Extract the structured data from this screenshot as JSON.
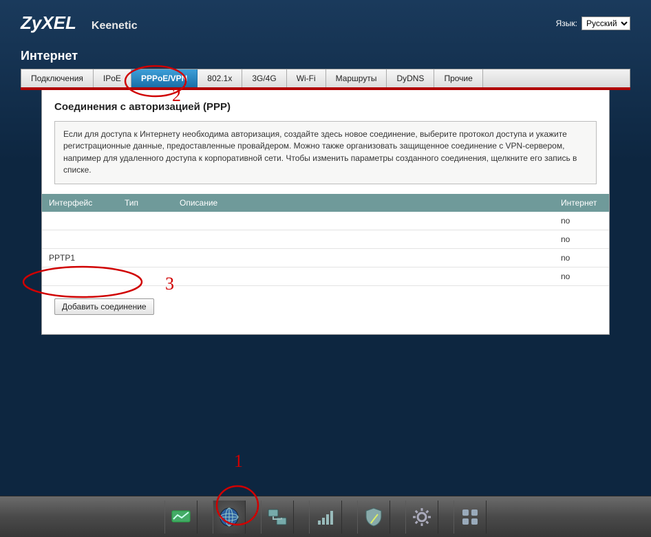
{
  "header": {
    "logo_text": "ZyXEL",
    "product": "Keenetic",
    "lang_label": "Язык:",
    "lang_value": "Русский"
  },
  "section_title": "Интернет",
  "tabs": [
    {
      "label": "Подключения",
      "active": false
    },
    {
      "label": "IPoE",
      "active": false
    },
    {
      "label": "PPPoE/VPN",
      "active": true
    },
    {
      "label": "802.1x",
      "active": false
    },
    {
      "label": "3G/4G",
      "active": false
    },
    {
      "label": "Wi-Fi",
      "active": false
    },
    {
      "label": "Маршруты",
      "active": false
    },
    {
      "label": "DyDNS",
      "active": false
    },
    {
      "label": "Прочие",
      "active": false
    }
  ],
  "panel": {
    "title": "Соединения с авторизацией (PPP)",
    "info": "Если для доступа к Интернету необходима авторизация, создайте здесь новое соединение, выберите протокол доступа и укажите регистрационные данные, предоставленные провайдером. Можно также организовать защищенное соединение с VPN-сервером, например для удаленного доступа к корпоративной сети. Чтобы изменить параметры созданного соединения, щелкните его запись в списке.",
    "columns": {
      "iface": "Интерфейс",
      "type": "Тип",
      "desc": "Описание",
      "internet": "Интернет"
    },
    "rows": [
      {
        "iface": "",
        "type": "",
        "desc": "",
        "internet": "no"
      },
      {
        "iface": "",
        "type": "",
        "desc": "",
        "internet": "no"
      },
      {
        "iface": "PPTP1",
        "type": "",
        "desc": "",
        "internet": "no"
      },
      {
        "iface": "",
        "type": "",
        "desc": "",
        "internet": "no"
      }
    ],
    "add_button": "Добавить соединение"
  },
  "dock": [
    {
      "name": "monitor-icon",
      "active": false
    },
    {
      "name": "globe-icon",
      "active": true
    },
    {
      "name": "lan-icon",
      "active": false
    },
    {
      "name": "wifi-bars-icon",
      "active": false
    },
    {
      "name": "shield-icon",
      "active": false
    },
    {
      "name": "gear-icon",
      "active": false
    },
    {
      "name": "apps-grid-icon",
      "active": false
    }
  ],
  "annotations": {
    "label1": "1",
    "label2": "2",
    "label3": "3"
  }
}
